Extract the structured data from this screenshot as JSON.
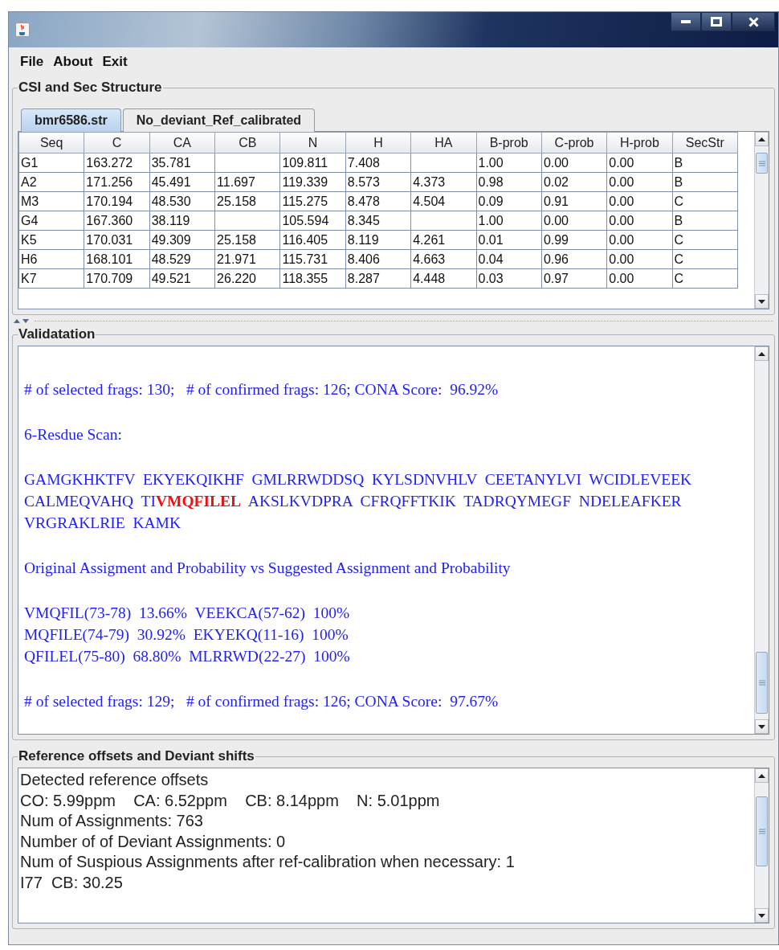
{
  "menu": [
    "File",
    "About",
    "Exit"
  ],
  "csi_panel": {
    "title": "CSI and Sec Structure",
    "tabs": [
      {
        "label": "bmr6586.str",
        "selected": true
      },
      {
        "label": "No_deviant_Ref_calibrated",
        "selected": false
      }
    ],
    "table": {
      "columns": [
        "Seq",
        "C",
        "CA",
        "CB",
        "N",
        "H",
        "HA",
        "B-prob",
        "C-prob",
        "H-prob",
        "SecStr"
      ],
      "rows": [
        [
          "G1",
          "163.272",
          "35.781",
          null,
          "109.811",
          "7.408",
          null,
          "1.00",
          "0.00",
          "0.00",
          "B"
        ],
        [
          "A2",
          "171.256",
          "45.491",
          "11.697",
          "119.339",
          "8.573",
          "4.373",
          "0.98",
          "0.02",
          "0.00",
          "B"
        ],
        [
          "M3",
          "170.194",
          "48.530",
          "25.158",
          "115.275",
          "8.478",
          "4.504",
          "0.09",
          "0.91",
          "0.00",
          "C"
        ],
        [
          "G4",
          "167.360",
          "38.119",
          null,
          "105.594",
          "8.345",
          null,
          "1.00",
          "0.00",
          "0.00",
          "B"
        ],
        [
          "K5",
          "170.031",
          "49.309",
          "25.158",
          "116.405",
          "8.119",
          "4.261",
          "0.01",
          "0.99",
          "0.00",
          "C"
        ],
        [
          "H6",
          "168.101",
          "48.529",
          "21.971",
          "115.731",
          "8.406",
          "4.663",
          "0.04",
          "0.96",
          "0.00",
          "C"
        ],
        [
          "K7",
          "170.709",
          "49.521",
          "26.220",
          "118.355",
          "8.287",
          "4.448",
          "0.03",
          "0.97",
          "0.00",
          "C"
        ]
      ]
    }
  },
  "validation_panel": {
    "title": "Validatation",
    "paragraphs": [
      {
        "kind": "lines",
        "lines": [
          "# of selected frags: 130;   # of confirmed frags: 126; CONA Score:  96.92%"
        ]
      },
      {
        "kind": "lines",
        "lines": [
          "6-Resdue Scan:"
        ]
      },
      {
        "kind": "sequence",
        "lines": [
          [
            {
              "text": "GAMGKHKTFV  EKYEKQIKHF  GMLRRWDDSQ  KYLSDNVHLV  CEETANYLVI  WCIDLEVEEK",
              "highlighted": false
            }
          ],
          [
            {
              "text": "CALMEQVAHQ  TI",
              "highlighted": false
            },
            {
              "text": "VMQFILEL",
              "highlighted": true
            },
            {
              "text": "  AKSLKVDPRA  CFRQFFTKIK  TADRQYMEGF  NDELEAFKER",
              "highlighted": false
            }
          ],
          [
            {
              "text": "VRGRAKLRIE  KAMK",
              "highlighted": false
            }
          ]
        ]
      },
      {
        "kind": "lines",
        "lines": [
          "Original Assigment and Probability vs Suggested Assignment and Probability"
        ]
      },
      {
        "kind": "lines",
        "lines": [
          "VMQFIL(73-78)  13.66%  VEEKCA(57-62)  100%",
          "MQFILE(74-79)  30.92%  EKYEKQ(11-16)  100%",
          "QFILEL(75-80)  68.80%  MLRRWD(22-27)  100%"
        ]
      },
      {
        "kind": "lines",
        "lines": [
          "# of selected frags: 129;   # of confirmed frags: 126; CONA Score:  97.67%"
        ]
      }
    ]
  },
  "reference_panel": {
    "title": "Reference offsets and Deviant shifts",
    "lines": [
      "Detected reference offsets",
      "CO: 5.99ppm    CA: 6.52ppm    CB: 8.14ppm    N: 5.01ppm",
      "Num of Assignments: 763",
      "Number of of Deviant Assignments: 0",
      "Num of Suspious Assignments after ref-calibration when necessary: 1",
      "I77  CB: 30.25"
    ]
  }
}
